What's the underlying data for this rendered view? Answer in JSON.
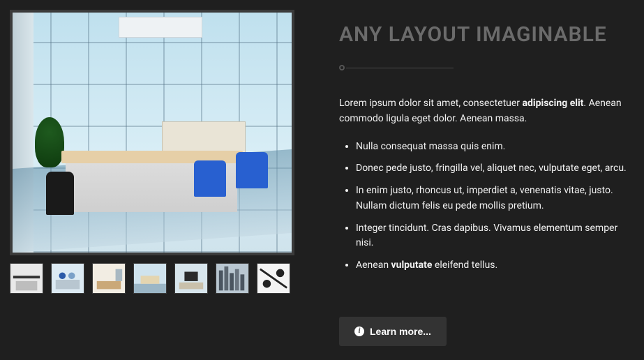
{
  "heading": "ANY LAYOUT IMAGINABLE",
  "intro": {
    "pre": "Lorem ipsum dolor sit amet, consectetuer ",
    "bold": "adipiscing elit",
    "post": ". Aenean commodo ligula eget dolor. Aenean massa."
  },
  "bullets": [
    {
      "pre": "Nulla consequat massa quis enim.",
      "bold": "",
      "post": ""
    },
    {
      "pre": "Donec pede justo, fringilla vel, aliquet nec, vulputate eget, arcu.",
      "bold": "",
      "post": ""
    },
    {
      "pre": "In enim justo, rhoncus ut, imperdiet a, venenatis vitae, justo. Nullam dictum felis eu pede mollis pretium.",
      "bold": "",
      "post": ""
    },
    {
      "pre": "Integer tincidunt. Cras dapibus. Vivamus elementum semper nisi.",
      "bold": "",
      "post": ""
    },
    {
      "pre": "Aenean ",
      "bold": "vulputate",
      "post": " eleifend tellus."
    }
  ],
  "button": {
    "label": "Learn more..."
  },
  "gallery": {
    "main_alt": "Modern office interior with glass walls, desk and blue chairs",
    "thumbs": [
      {
        "name": "thumb-office-bw"
      },
      {
        "name": "thumb-meeting"
      },
      {
        "name": "thumb-lounge"
      },
      {
        "name": "thumb-open-office"
      },
      {
        "name": "thumb-workstation"
      },
      {
        "name": "thumb-cityscape"
      },
      {
        "name": "thumb-blueprint"
      }
    ]
  }
}
